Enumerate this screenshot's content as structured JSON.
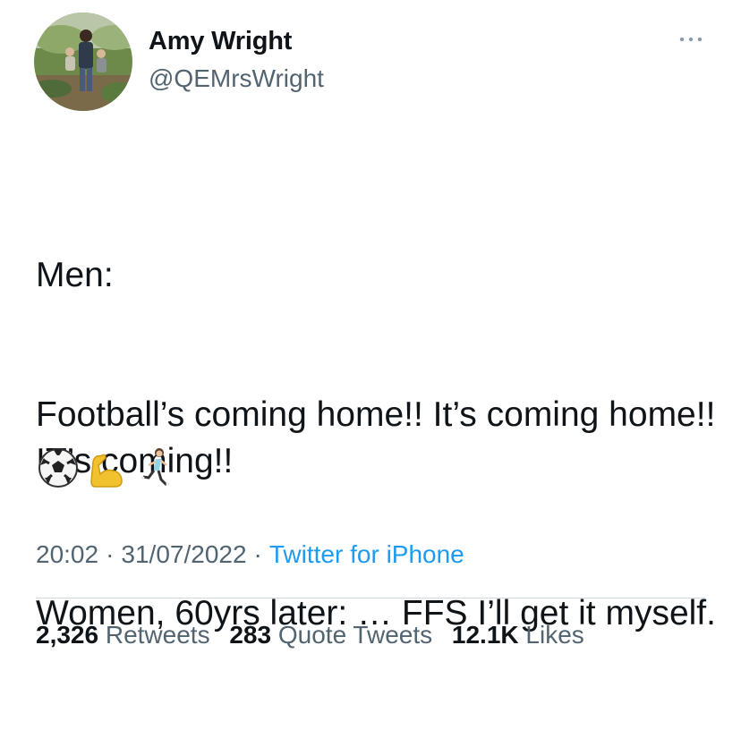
{
  "author": {
    "name": "Amy Wright",
    "handle": "@QEMrsWright",
    "avatar_icon": "profile-photo"
  },
  "more_icon": "ellipsis-icon",
  "tweet": {
    "line1": "Men:",
    "line2": "Football’s coming home!! It’s coming home!! IT’s coming!!",
    "line3": "Women, 60yrs later: … FFS I’ll get it myself.",
    "emojis": [
      "soccer-ball-icon",
      "flexed-biceps-icon",
      "woman-running-icon"
    ]
  },
  "meta": {
    "time": "20:02",
    "date": "31/07/2022",
    "separator": "·",
    "source": "Twitter for iPhone"
  },
  "stats": {
    "retweets_count": "2,326",
    "retweets_label": "Retweets",
    "quotes_count": "283",
    "quotes_label": "Quote Tweets",
    "likes_count": "12.1K",
    "likes_label": "Likes"
  },
  "colors": {
    "text": "#0f1419",
    "secondary": "#536471",
    "link": "#1d9bf0",
    "divider": "#cfd9de"
  }
}
